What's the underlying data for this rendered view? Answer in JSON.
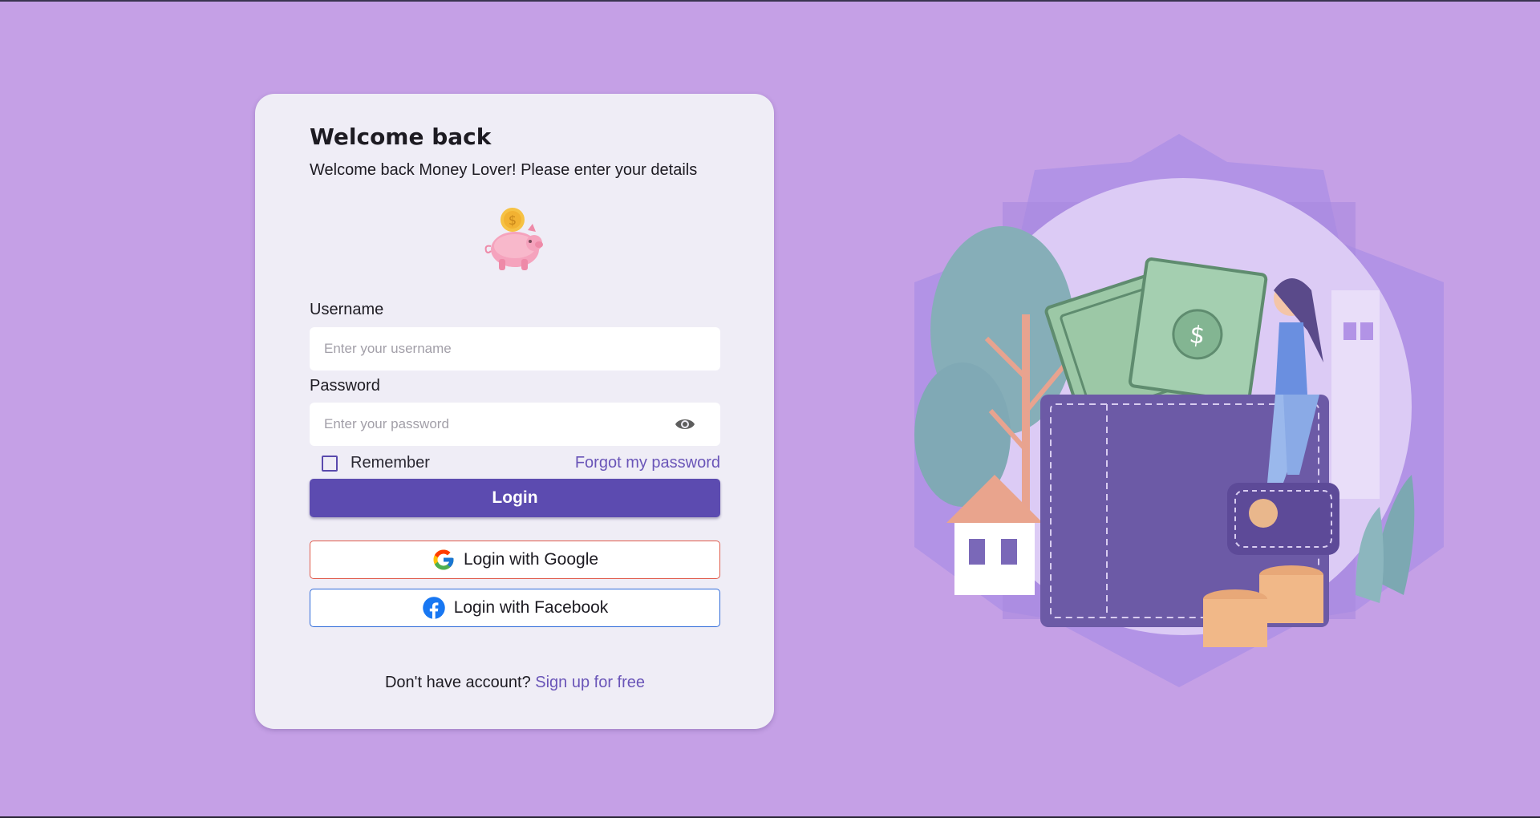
{
  "login": {
    "title": "Welcome back",
    "subtitle": "Welcome back Money Lover! Please enter your details",
    "logo_icon": "piggy-bank-icon",
    "username_label": "Username",
    "username_placeholder": "Enter your username",
    "username_value": "",
    "password_label": "Password",
    "password_placeholder": "Enter your password",
    "password_value": "",
    "show_password_icon": "eye-icon",
    "remember_label": "Remember",
    "remember_checked": false,
    "forgot_label": "Forgot my password",
    "login_label": "Login",
    "google_label": "Login with Google",
    "facebook_label": "Login with Facebook",
    "no_account_text": "Don't have account?",
    "signup_label": "Sign up for free"
  },
  "illustration": {
    "icon": "wallet-illustration"
  },
  "colors": {
    "background": "#c5a0e6",
    "card": "#efedf6",
    "primary": "#5c4bb0",
    "link": "#6a55b8",
    "google_border": "#e05a4a",
    "facebook_border": "#2f6ad9"
  }
}
